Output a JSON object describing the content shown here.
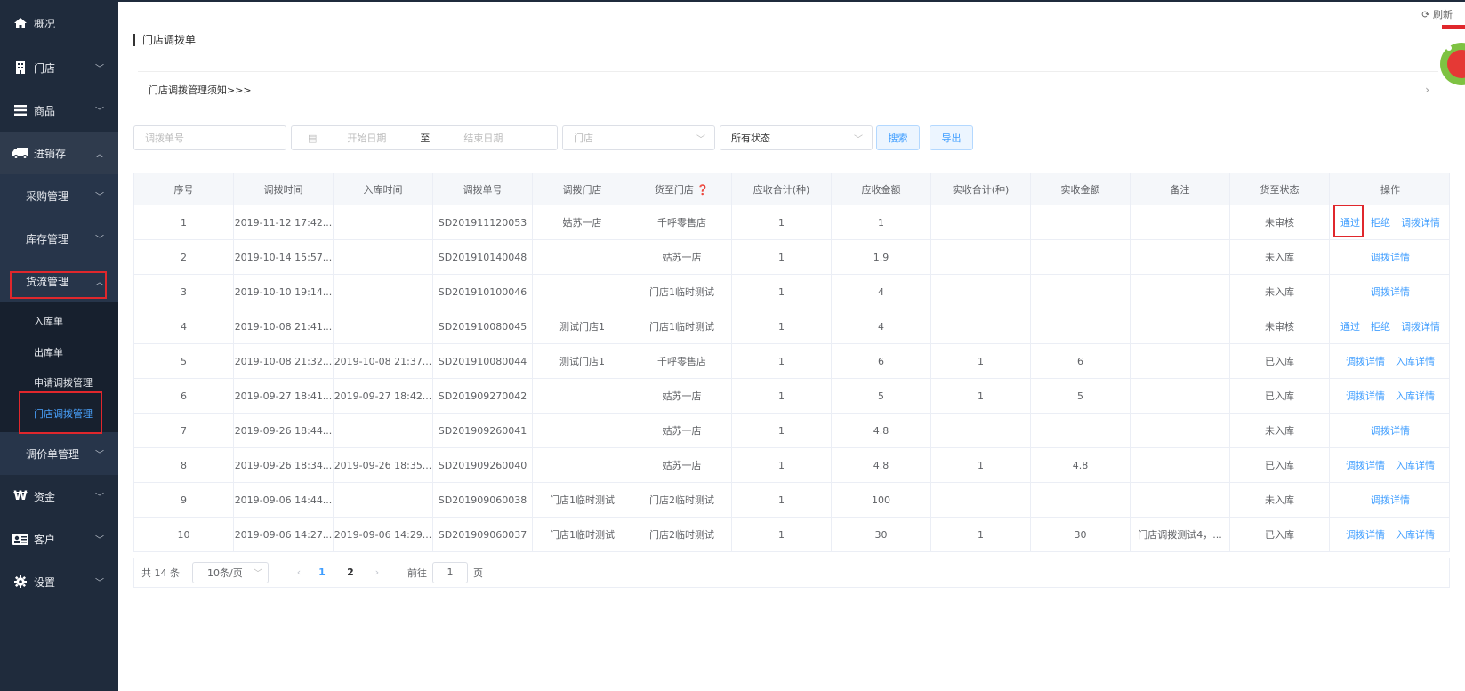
{
  "sidebar": {
    "items": [
      {
        "label": "概况",
        "icon": "home-icon"
      },
      {
        "label": "门店",
        "icon": "store-icon"
      },
      {
        "label": "商品",
        "icon": "list-icon"
      },
      {
        "label": "进销存",
        "icon": "truck-icon"
      },
      {
        "label": "资金",
        "icon": "money-icon"
      },
      {
        "label": "客户",
        "icon": "id-card-icon"
      },
      {
        "label": "设置",
        "icon": "gear-icon"
      }
    ],
    "sub": {
      "purchase": "采购管理",
      "inventory": "库存管理",
      "logistics": "货流管理",
      "price": "调价单管理"
    },
    "leaves": [
      "入库单",
      "出库单",
      "申请调拨管理",
      "门店调拨管理"
    ]
  },
  "header": {
    "title": "门店调拨单",
    "refresh": "刷新",
    "notice": "门店调拨管理须知>>>"
  },
  "filters": {
    "order_placeholder": "调拨单号",
    "start_placeholder": "开始日期",
    "to": "至",
    "end_placeholder": "结束日期",
    "store_placeholder": "门店",
    "status_value": "所有状态",
    "search": "搜索",
    "export": "导出"
  },
  "table": {
    "headers": [
      "序号",
      "调拨时间",
      "入库时间",
      "调拨单号",
      "调拨门店",
      "货至门店 ❓",
      "应收合计(种)",
      "应收金额",
      "实收合计(种)",
      "实收金额",
      "备注",
      "货至状态",
      "操作"
    ],
    "rows": [
      [
        "1",
        "2019-11-12 17:42...",
        "",
        "SD201911120053",
        "姑苏一店",
        "千呼零售店",
        "1",
        "1",
        "",
        "",
        "",
        "未审核"
      ],
      [
        "2",
        "2019-10-14 15:57...",
        "",
        "SD201910140048",
        "",
        "姑苏一店",
        "1",
        "1.9",
        "",
        "",
        "",
        "未入库"
      ],
      [
        "3",
        "2019-10-10 19:14...",
        "",
        "SD201910100046",
        "",
        "门店1临时测试",
        "1",
        "4",
        "",
        "",
        "",
        "未入库"
      ],
      [
        "4",
        "2019-10-08 21:41...",
        "",
        "SD201910080045",
        "测试门店1",
        "门店1临时测试",
        "1",
        "4",
        "",
        "",
        "",
        "未审核"
      ],
      [
        "5",
        "2019-10-08 21:32...",
        "2019-10-08 21:37...",
        "SD201910080044",
        "测试门店1",
        "千呼零售店",
        "1",
        "6",
        "1",
        "6",
        "",
        "已入库"
      ],
      [
        "6",
        "2019-09-27 18:41...",
        "2019-09-27 18:42...",
        "SD201909270042",
        "",
        "姑苏一店",
        "1",
        "5",
        "1",
        "5",
        "",
        "已入库"
      ],
      [
        "7",
        "2019-09-26 18:44...",
        "",
        "SD201909260041",
        "",
        "姑苏一店",
        "1",
        "4.8",
        "",
        "",
        "",
        "未入库"
      ],
      [
        "8",
        "2019-09-26 18:34...",
        "2019-09-26 18:35...",
        "SD201909260040",
        "",
        "姑苏一店",
        "1",
        "4.8",
        "1",
        "4.8",
        "",
        "已入库"
      ],
      [
        "9",
        "2019-09-06 14:44...",
        "",
        "SD201909060038",
        "门店1临时测试",
        "门店2临时测试",
        "1",
        "100",
        "",
        "",
        "",
        "未入库"
      ],
      [
        "10",
        "2019-09-06 14:27...",
        "2019-09-06 14:29...",
        "SD201909060037",
        "门店1临时测试",
        "门店2临时测试",
        "1",
        "30",
        "1",
        "30",
        "门店调拨测试4，...",
        "已入库"
      ]
    ],
    "ops": [
      [
        "通过",
        "拒绝",
        "调拨详情"
      ],
      [
        "调拨详情"
      ],
      [
        "调拨详情"
      ],
      [
        "通过",
        "拒绝",
        "调拨详情"
      ],
      [
        "调拨详情",
        "入库详情"
      ],
      [
        "调拨详情",
        "入库详情"
      ],
      [
        "调拨详情"
      ],
      [
        "调拨详情",
        "入库详情"
      ],
      [
        "调拨详情"
      ],
      [
        "调拨详情",
        "入库详情"
      ]
    ]
  },
  "pager": {
    "total": "共 14 条",
    "size": "10条/页",
    "pages": [
      "1",
      "2"
    ],
    "goto": "前往",
    "goto_value": "1",
    "page_unit": "页"
  },
  "colors": {
    "sidebar": "#1f2b3c",
    "accent": "#409eff",
    "highlight": "#e0272c"
  }
}
